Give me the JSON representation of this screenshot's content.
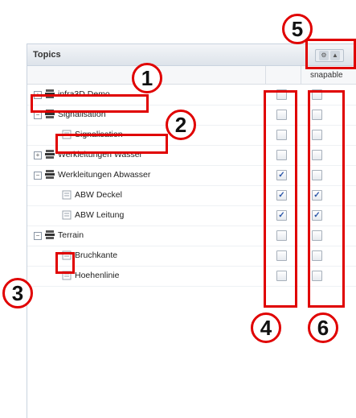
{
  "panel": {
    "title": "Topics",
    "column_header": "snapable",
    "tool_icons": [
      "gear-icon",
      "collapse-up-icon"
    ]
  },
  "rows": [
    {
      "label": "infra3D Demo",
      "expander": "+",
      "kind": "group",
      "visible": false,
      "snapable": false
    },
    {
      "label": "Signalisation",
      "expander": "−",
      "kind": "group",
      "visible": false,
      "snapable": false
    },
    {
      "label": "Signalisation",
      "kind": "layer",
      "visible": false,
      "snapable": false
    },
    {
      "label": "Werkleitungen Wasser",
      "expander": "+",
      "kind": "group",
      "visible": false,
      "snapable": false
    },
    {
      "label": "Werkleitungen Abwasser",
      "expander": "−",
      "kind": "group",
      "visible": true,
      "snapable": false
    },
    {
      "label": "ABW Deckel",
      "kind": "layer",
      "visible": true,
      "snapable": true
    },
    {
      "label": "ABW Leitung",
      "kind": "layer",
      "visible": true,
      "snapable": true
    },
    {
      "label": "Terrain",
      "expander": "−",
      "kind": "group",
      "visible": false,
      "snapable": false
    },
    {
      "label": "Bruchkante",
      "kind": "layer",
      "visible": false,
      "snapable": false
    },
    {
      "label": "Hoehenlinie",
      "kind": "layer",
      "visible": false,
      "snapable": false
    }
  ],
  "callouts": [
    "1",
    "2",
    "3",
    "4",
    "5",
    "6"
  ],
  "colors": {
    "callout": "#e00000",
    "check": "#2a55a8"
  }
}
